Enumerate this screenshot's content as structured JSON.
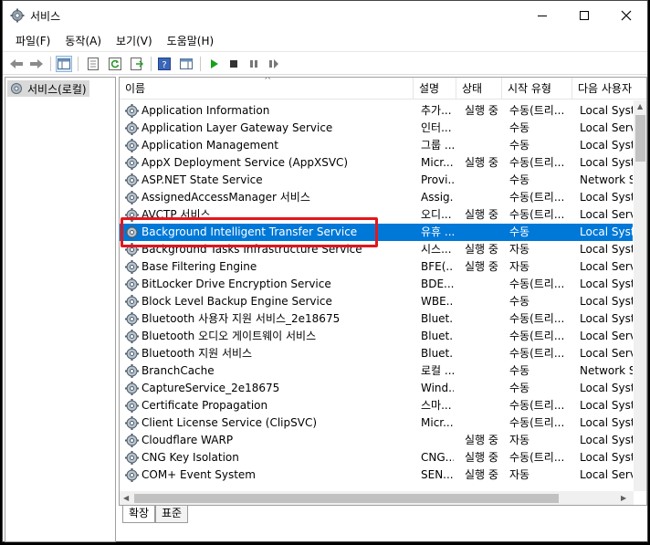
{
  "window": {
    "title": "서비스"
  },
  "menu": [
    "파일(F)",
    "동작(A)",
    "보기(V)",
    "도움말(H)"
  ],
  "tree": {
    "root_label": "서비스(로컬)"
  },
  "columns": [
    "이름",
    "설명",
    "상태",
    "시작 유형",
    "다음 사용자"
  ],
  "rows": [
    {
      "name": "Application Information",
      "desc": "추가...",
      "status": "실행 중",
      "start": "수동(트리...",
      "logon": "Local System"
    },
    {
      "name": "Application Layer Gateway Service",
      "desc": "인터...",
      "status": "",
      "start": "수동",
      "logon": "Local Service"
    },
    {
      "name": "Application Management",
      "desc": "그룹 ...",
      "status": "",
      "start": "수동",
      "logon": "Local System"
    },
    {
      "name": "AppX Deployment Service (AppXSVC)",
      "desc": "Micr...",
      "status": "실행 중",
      "start": "수동(트리...",
      "logon": "Local System"
    },
    {
      "name": "ASP.NET State Service",
      "desc": "Provi...",
      "status": "",
      "start": "수동",
      "logon": "Network Service"
    },
    {
      "name": "AssignedAccessManager 서비스",
      "desc": "Assig...",
      "status": "",
      "start": "수동(트리...",
      "logon": "Local System"
    },
    {
      "name": "AVCTP 서비스",
      "desc": "오디...",
      "status": "실행 중",
      "start": "수동(트리...",
      "logon": "Local Service"
    },
    {
      "name": "Background Intelligent Transfer Service",
      "desc": "유휴 ...",
      "status": "",
      "start": "수동",
      "logon": "Local System"
    },
    {
      "name": "Background Tasks Infrastructure Service",
      "desc": "시스...",
      "status": "실행 중",
      "start": "자동",
      "logon": "Local System"
    },
    {
      "name": "Base Filtering Engine",
      "desc": "BFE(...",
      "status": "실행 중",
      "start": "자동",
      "logon": "Local Service"
    },
    {
      "name": "BitLocker Drive Encryption Service",
      "desc": "BDE...",
      "status": "",
      "start": "수동(트리...",
      "logon": "Local System"
    },
    {
      "name": "Block Level Backup Engine Service",
      "desc": "WBE...",
      "status": "",
      "start": "수동",
      "logon": "Local System"
    },
    {
      "name": "Bluetooth 사용자 지원 서비스_2e18675",
      "desc": "Bluet...",
      "status": "",
      "start": "수동(트리...",
      "logon": "Local System"
    },
    {
      "name": "Bluetooth 오디오 게이트웨이 서비스",
      "desc": "Bluet...",
      "status": "",
      "start": "수동(트리...",
      "logon": "Local Service"
    },
    {
      "name": "Bluetooth 지원 서비스",
      "desc": "Bluet...",
      "status": "",
      "start": "수동(트리...",
      "logon": "Local Service"
    },
    {
      "name": "BranchCache",
      "desc": "로컬 ...",
      "status": "",
      "start": "수동",
      "logon": "Network Service"
    },
    {
      "name": "CaptureService_2e18675",
      "desc": "Wind...",
      "status": "",
      "start": "수동",
      "logon": "Local System"
    },
    {
      "name": "Certificate Propagation",
      "desc": "스마...",
      "status": "",
      "start": "수동(트리...",
      "logon": "Local System"
    },
    {
      "name": "Client License Service (ClipSVC)",
      "desc": "Micr...",
      "status": "",
      "start": "수동(트리...",
      "logon": "Local System"
    },
    {
      "name": "Cloudflare WARP",
      "desc": "",
      "status": "실행 중",
      "start": "자동",
      "logon": "Local System"
    },
    {
      "name": "CNG Key Isolation",
      "desc": "CNG...",
      "status": "실행 중",
      "start": "수동(트리...",
      "logon": "Local System"
    },
    {
      "name": "COM+ Event System",
      "desc": "SEN...",
      "status": "실행 중",
      "start": "자동",
      "logon": "Local Service"
    }
  ],
  "selected_row": 7,
  "tabs": [
    "확장",
    "표준"
  ],
  "colors": {
    "selection": "#0078d7",
    "highlight_box": "#e3161d"
  }
}
